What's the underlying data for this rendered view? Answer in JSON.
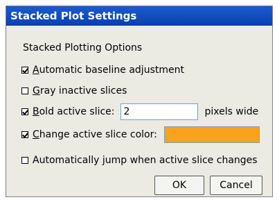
{
  "window": {
    "title": "Stacked Plot Settings"
  },
  "group_label": "Stacked Plotting Options",
  "options": {
    "auto_baseline": {
      "checked": true,
      "label_u": "A",
      "label_rest": "utomatic baseline adjustment"
    },
    "gray_inactive": {
      "checked": false,
      "label_u": "G",
      "label_rest": "ray inactive slices"
    },
    "bold_active": {
      "checked": true,
      "label_u": "B",
      "label_rest": "old active slice:",
      "value": "2",
      "suffix": "pixels wide"
    },
    "change_color": {
      "checked": true,
      "label_u": "C",
      "label_rest": "hange active slice color:",
      "color": "#f9a21c"
    },
    "auto_jump": {
      "checked": false,
      "label_pre": "Automatically ",
      "label_u": "j",
      "label_rest": "ump when active slice changes"
    }
  },
  "buttons": {
    "ok": "OK",
    "cancel": "Cancel"
  }
}
